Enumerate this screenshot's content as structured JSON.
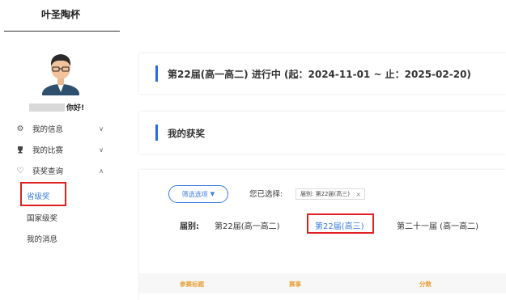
{
  "sidebar": {
    "brand": "叶圣陶杯",
    "greeting": "你好!",
    "menu": [
      {
        "label": "我的信息",
        "icon": "gear-icon",
        "expanded": false
      },
      {
        "label": "我的比赛",
        "icon": "trophy-icon",
        "expanded": false
      },
      {
        "label": "获奖查询",
        "icon": "heart-icon",
        "expanded": true
      }
    ],
    "sub_items": [
      {
        "label": "省级奖",
        "active": true
      },
      {
        "label": "国家级奖",
        "active": false
      },
      {
        "label": "我的消息",
        "active": false
      }
    ]
  },
  "main": {
    "session_banner": "第22届(高一高二) 进行中 (起：2024-11-01 ~ 止：2025-02-20)",
    "awards_title": "我的获奖",
    "filter": {
      "button_label": "筛选选项",
      "selected_label": "您已选择:",
      "selected_tag": "届别: 第22届(高三)",
      "session_label": "届别:",
      "options": [
        {
          "label": "第22届(高一高二)",
          "active": false
        },
        {
          "label": "第22届(高三)",
          "active": true
        },
        {
          "label": "第二十一届 (高一高二)",
          "active": false
        }
      ]
    },
    "table_headers": [
      "参赛标题",
      "赛事",
      "分数"
    ]
  },
  "colors": {
    "accent": "#3a7be0",
    "highlight": "#e02020",
    "header_text": "#e6a23c"
  }
}
